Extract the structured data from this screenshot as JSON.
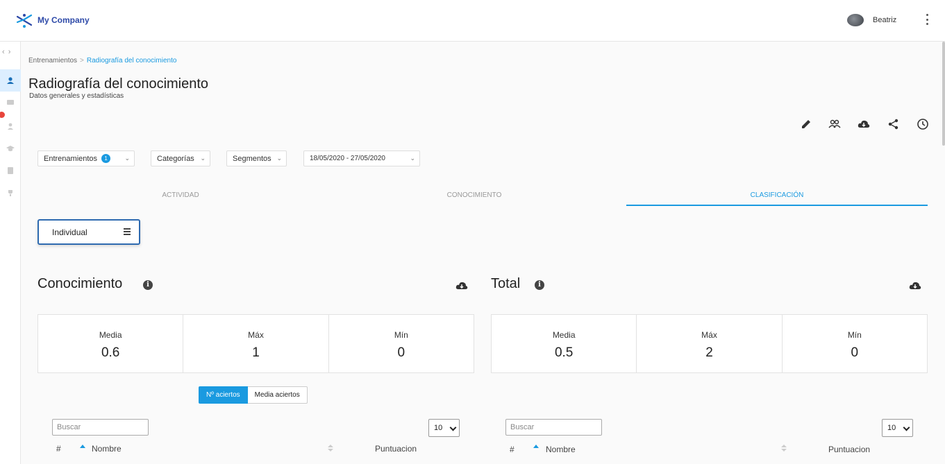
{
  "header": {
    "brand": "My Company",
    "user_name": "Beatriz"
  },
  "breadcrumb": {
    "parent": "Entrenamientos",
    "separator": ">",
    "current": "Radiografía del conocimiento"
  },
  "page": {
    "title": "Radiografía del conocimiento",
    "subtitle": "Datos generales y estadísticas"
  },
  "toolbar": {
    "icons": [
      "pencil-icon",
      "users-icon",
      "cloud-download-icon",
      "share-icon",
      "clock-icon"
    ]
  },
  "filters": {
    "trainings": {
      "label": "Entrenamientos",
      "badge": "1"
    },
    "categories": {
      "label": "Categorías"
    },
    "segments": {
      "label": "Segmentos"
    },
    "date_range": {
      "label": "18/05/2020 - 27/05/2020"
    }
  },
  "tabs": [
    {
      "label": "ACTIVIDAD",
      "active": false
    },
    {
      "label": "CONOCIMIENTO",
      "active": false
    },
    {
      "label": "CLASIFICACIÓN",
      "active": true
    }
  ],
  "view_selector": {
    "label": "Individual"
  },
  "knowledge": {
    "title": "Conocimiento",
    "stats": [
      {
        "label": "Media",
        "value": "0.6"
      },
      {
        "label": "Máx",
        "value": "1"
      },
      {
        "label": "Mín",
        "value": "0"
      }
    ]
  },
  "total": {
    "title": "Total",
    "stats": [
      {
        "label": "Media",
        "value": "0.5"
      },
      {
        "label": "Máx",
        "value": "2"
      },
      {
        "label": "Mín",
        "value": "0"
      }
    ]
  },
  "toggle": {
    "option_a": "Nº aciertos",
    "option_b": "Media aciertos",
    "selected": "Nº aciertos"
  },
  "left_table": {
    "search_placeholder": "Buscar",
    "page_size": "10",
    "columns": [
      "#",
      "Nombre",
      "Puntuacion"
    ]
  },
  "right_table": {
    "search_placeholder": "Buscar",
    "page_size": "10",
    "columns": [
      "#",
      "Nombre",
      "Puntuacion"
    ]
  },
  "colors": {
    "accent": "#1a9ae0",
    "brand": "#2e4aa8",
    "notification": "#e8453c"
  }
}
